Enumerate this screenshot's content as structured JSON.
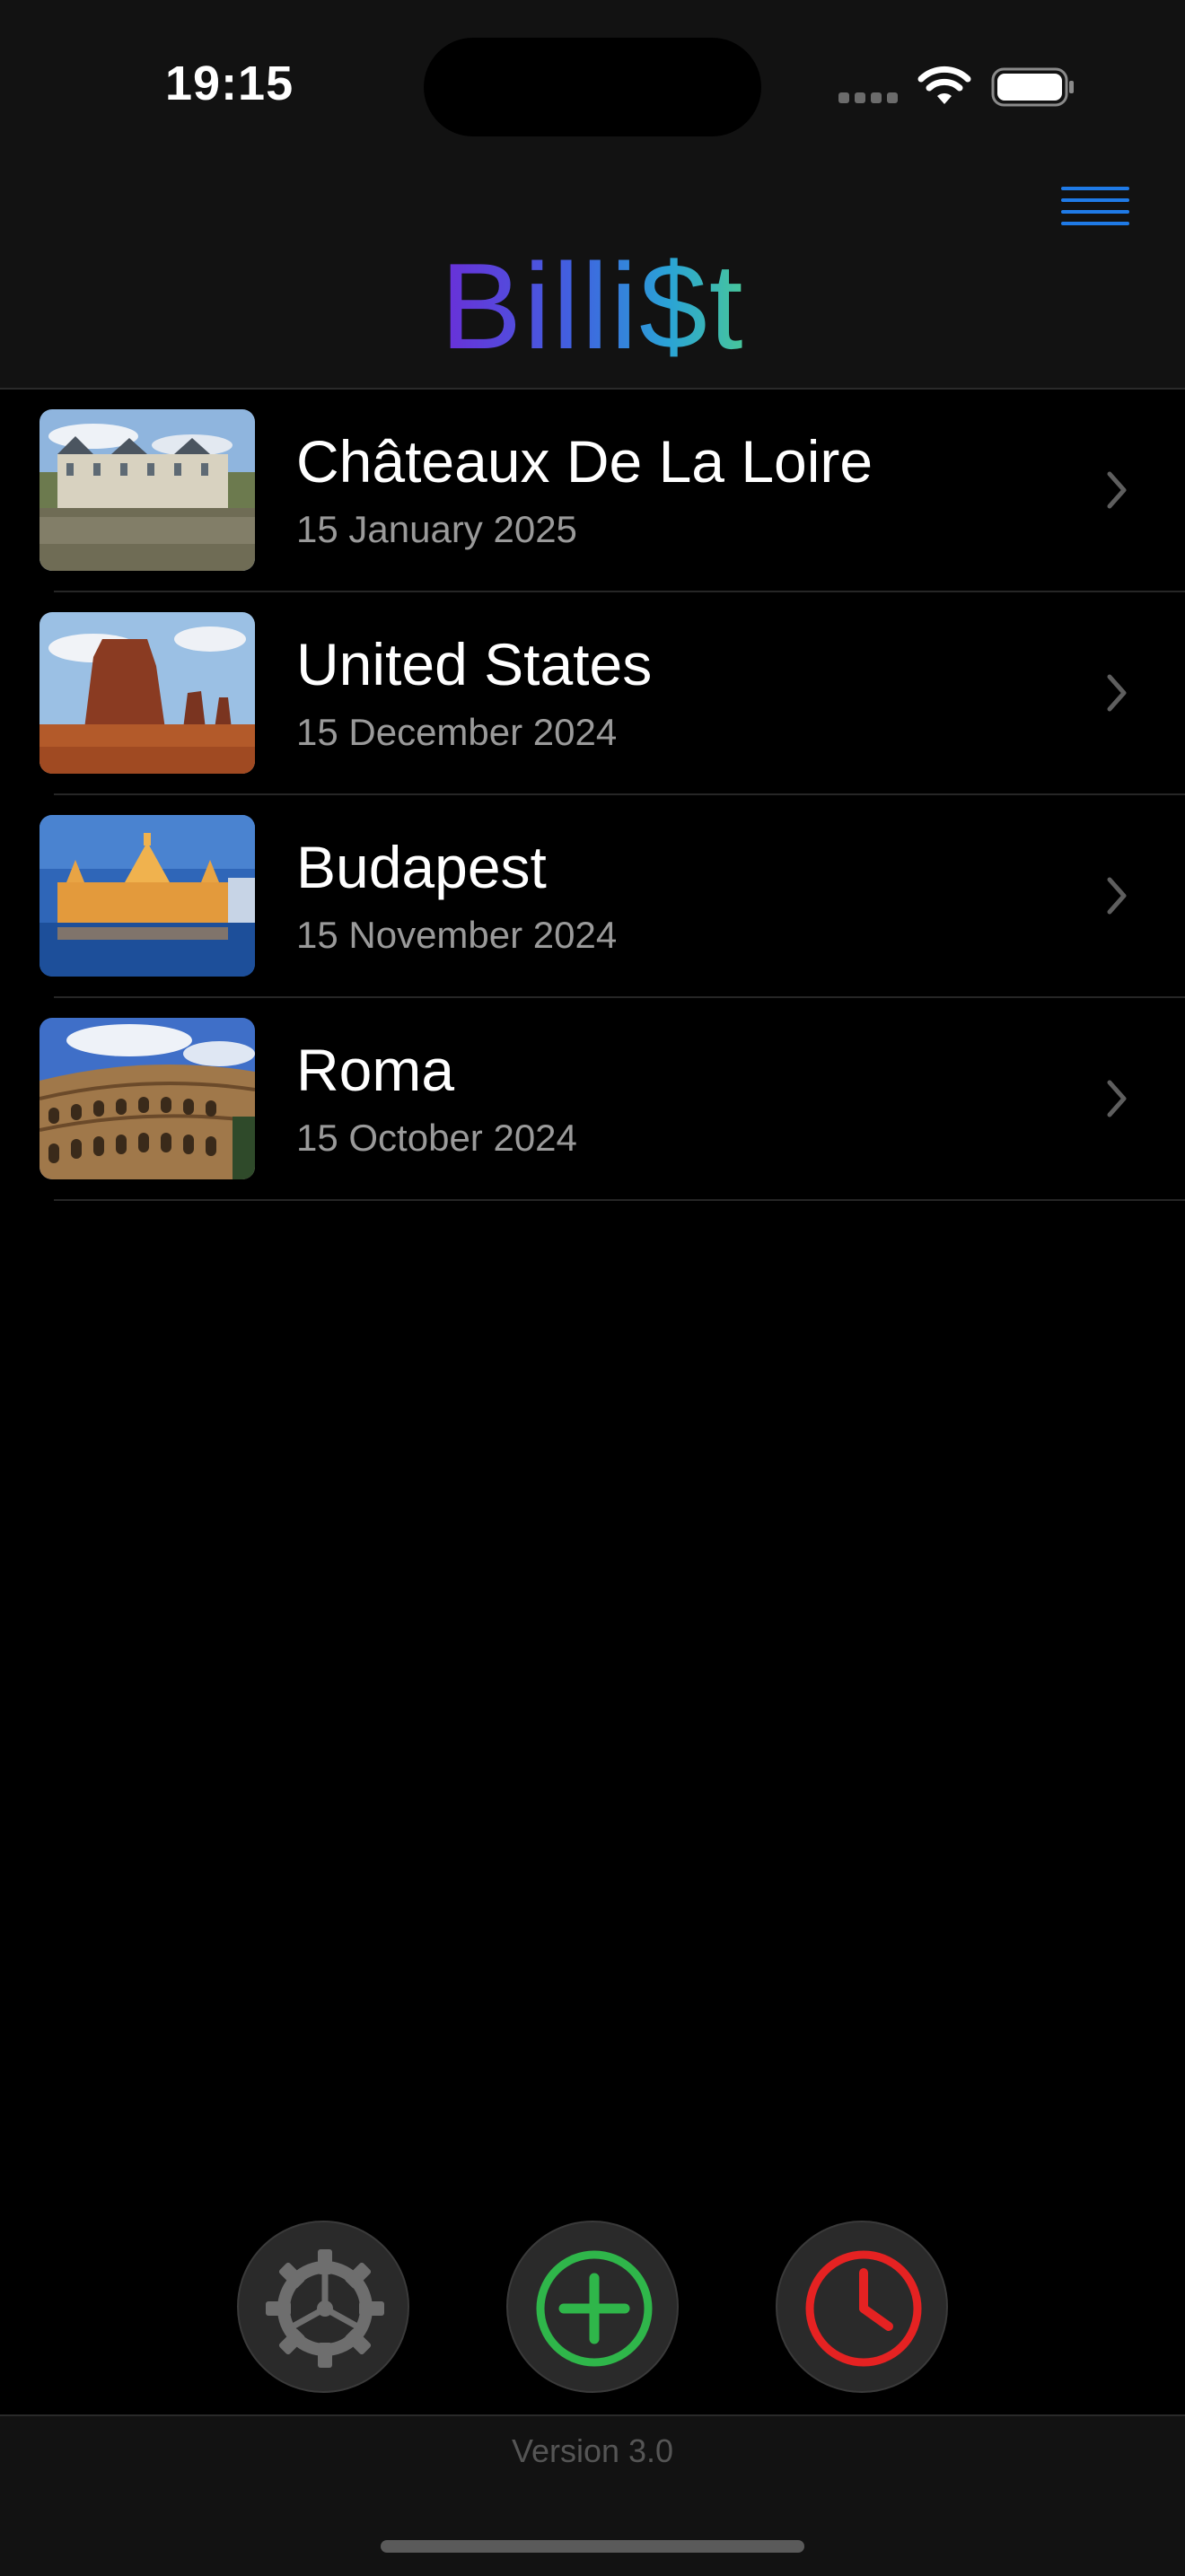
{
  "status_bar": {
    "time": "19:15"
  },
  "header": {
    "app_title": "Billi$t",
    "menu_icon": "hamburger-menu-icon"
  },
  "trips": [
    {
      "name": "Châteaux De La Loire",
      "date": "15 January 2025",
      "image": "chateau-photo"
    },
    {
      "name": "United States",
      "date": "15 December 2024",
      "image": "monument-valley-photo"
    },
    {
      "name": "Budapest",
      "date": "15 November 2024",
      "image": "parliament-photo"
    },
    {
      "name": "Roma",
      "date": "15 October 2024",
      "image": "colosseum-photo"
    }
  ],
  "toolbar": {
    "settings_icon": "gear-icon",
    "add_icon": "plus-circle-icon",
    "history_icon": "clock-icon"
  },
  "colors": {
    "accent_blue": "#1f7ae6",
    "add_green": "#2fb64a",
    "history_red": "#e52222",
    "settings_gray": "#6e6e6e"
  },
  "footer": {
    "version": "Version 3.0"
  }
}
